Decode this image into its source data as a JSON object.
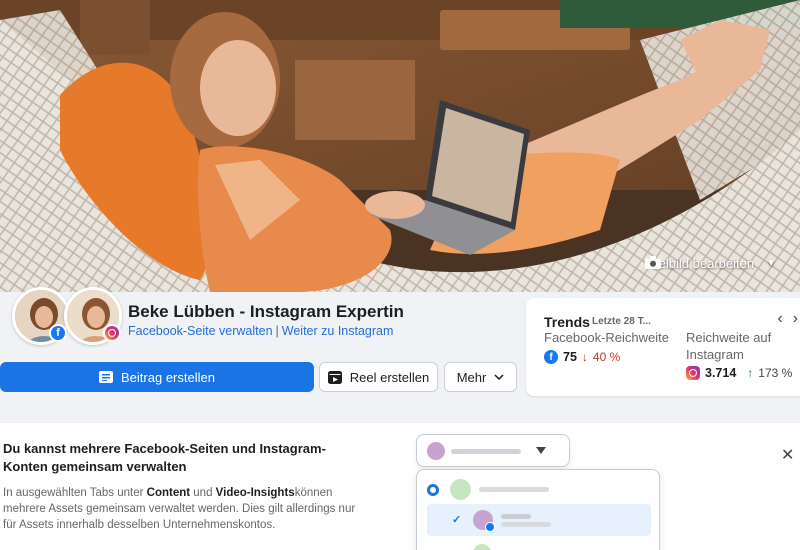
{
  "cover": {
    "edit_label": "Titelbild bearbeiten",
    "edit_icon": "camera-icon"
  },
  "page": {
    "name": "Beke Lübben - Instagram Expertin",
    "manage_link": "Facebook-Seite verwalten",
    "separator": "|",
    "instagram_link": "Weiter zu Instagram"
  },
  "buttons": {
    "create_post": "Beitrag erstellen",
    "create_reel": "Reel erstellen",
    "more": "Mehr"
  },
  "trends": {
    "title": "Trends",
    "period": "Letzte 28 T...",
    "facebook": {
      "label": "Facebook-Reichweite",
      "value": "75",
      "change": "40 %",
      "direction": "down"
    },
    "instagram": {
      "label_line1": "Reichweite auf",
      "label_line2": "Instagram",
      "value": "3.714",
      "change": "173 %",
      "direction": "up"
    }
  },
  "info": {
    "title": "Du kannst mehrere Facebook-Seiten und Instagram-Konten gemeinsam verwalten",
    "text_before": "In ausgewählten Tabs unter ",
    "bold1": "Content",
    "text_mid": " und ",
    "bold2": "Video-Insights",
    "text_after": "können mehrere Assets gemeinsam verwaltet werden. Dies gilt allerdings nur für Assets innerhalb desselben Unternehmenskontos."
  },
  "colors": {
    "primary": "#1b74e4",
    "link": "#216fdb",
    "down": "#c53929",
    "up": "#1c7a2b"
  }
}
